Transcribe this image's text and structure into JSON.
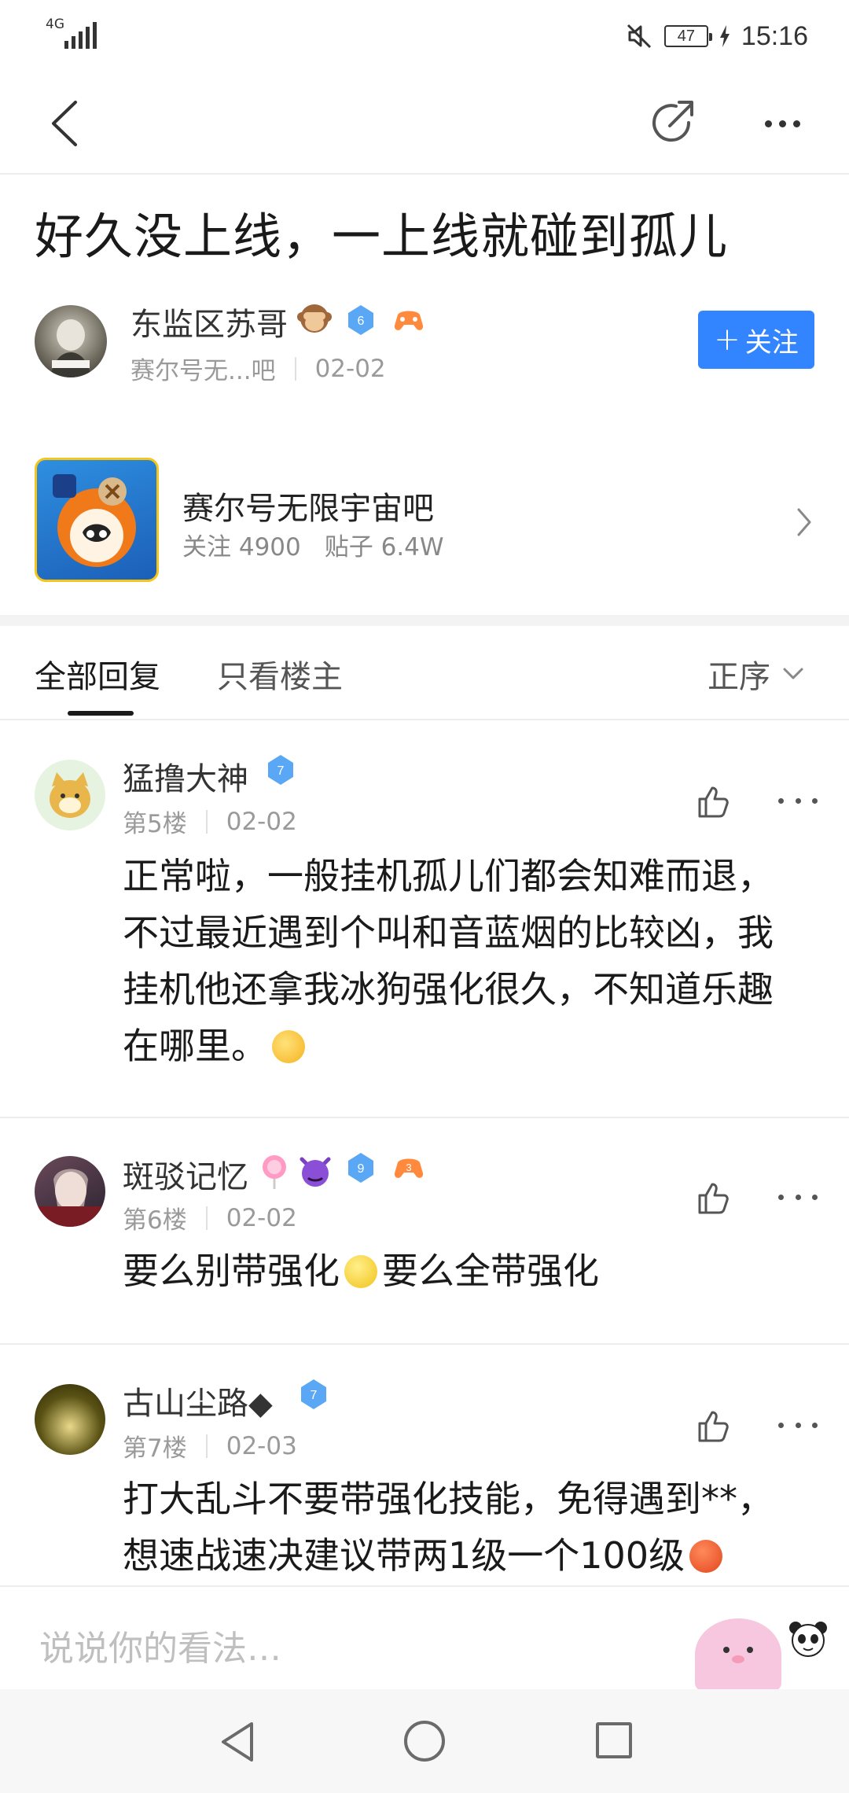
{
  "status_bar": {
    "network": "4G",
    "battery": "47",
    "time": "15:16"
  },
  "post": {
    "title": "好久没上线，一上线就碰到孤儿",
    "author": {
      "name": "东监区苏哥",
      "level": "6",
      "forum_short": "赛尔号无...吧",
      "date": "02-02"
    },
    "follow_label": "关注"
  },
  "forum": {
    "name": "赛尔号无限宇宙吧",
    "followers": "关注 4900",
    "posts": "贴子 6.4W"
  },
  "tabs": {
    "all": "全部回复",
    "owner": "只看楼主",
    "sort": "正序"
  },
  "replies": [
    {
      "name": "猛撸大神",
      "level": "7",
      "floor": "第5楼",
      "date": "02-02",
      "lines": [
        "正常啦，一般挂机孤儿们都会知难而退，",
        "不过最近遇到个叫和音蓝烟的比较凶，我",
        "挂机他还拿我冰狗强化很久，不知道乐趣",
        "在哪里。"
      ]
    },
    {
      "name": "斑驳记忆",
      "level": "9",
      "game_level": "3",
      "floor": "第6楼",
      "date": "02-02",
      "text_a": "要么别带强化",
      "text_b": "要么全带强化"
    },
    {
      "name": "古山尘路◆",
      "level": "7",
      "floor": "第7楼",
      "date": "02-03",
      "lines": [
        "打大乱斗不要带强化技能，免得遇到**，",
        "想速战速决建议带两1级一个100级"
      ]
    }
  ],
  "comment_bar": {
    "placeholder": "说说你的看法…"
  },
  "colors": {
    "accent": "#3385ff",
    "level_badge": "#5aa8f5",
    "muted": "#9a9a9a"
  }
}
